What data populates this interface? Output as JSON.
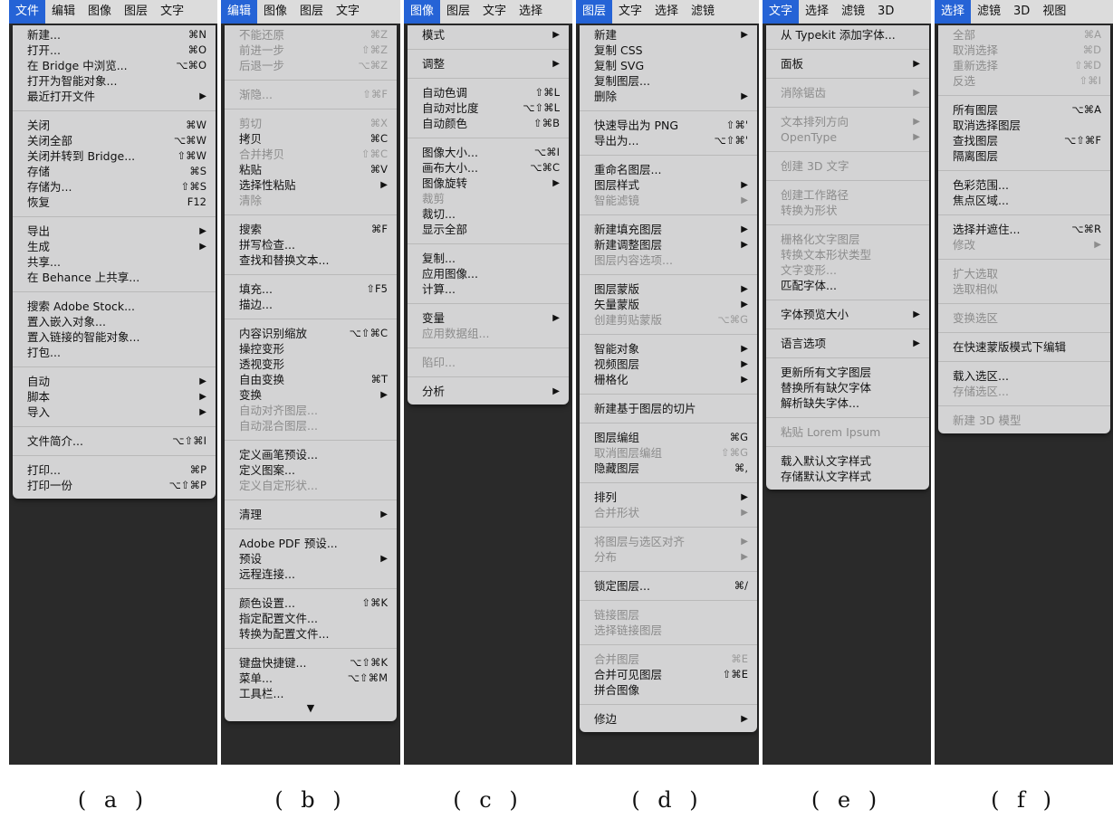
{
  "panels": [
    {
      "id": "a",
      "menubar": [
        "文件",
        "编辑",
        "图像",
        "图层",
        "文字"
      ],
      "active": 0,
      "items": [
        {
          "label": "新建...",
          "sc": "⌘N"
        },
        {
          "label": "打开...",
          "sc": "⌘O"
        },
        {
          "label": "在 Bridge 中浏览...",
          "sc": "⌥⌘O"
        },
        {
          "label": "打开为智能对象..."
        },
        {
          "label": "最近打开文件",
          "sub": true
        },
        {
          "sep": true
        },
        {
          "label": "关闭",
          "sc": "⌘W"
        },
        {
          "label": "关闭全部",
          "sc": "⌥⌘W"
        },
        {
          "label": "关闭并转到 Bridge...",
          "sc": "⇧⌘W"
        },
        {
          "label": "存储",
          "sc": "⌘S"
        },
        {
          "label": "存储为...",
          "sc": "⇧⌘S"
        },
        {
          "label": "恢复",
          "sc": "F12"
        },
        {
          "sep": true
        },
        {
          "label": "导出",
          "sub": true
        },
        {
          "label": "生成",
          "sub": true
        },
        {
          "label": "共享..."
        },
        {
          "label": "在 Behance 上共享..."
        },
        {
          "sep": true
        },
        {
          "label": "搜索 Adobe Stock..."
        },
        {
          "label": "置入嵌入对象..."
        },
        {
          "label": "置入链接的智能对象..."
        },
        {
          "label": "打包..."
        },
        {
          "sep": true
        },
        {
          "label": "自动",
          "sub": true
        },
        {
          "label": "脚本",
          "sub": true
        },
        {
          "label": "导入",
          "sub": true
        },
        {
          "sep": true
        },
        {
          "label": "文件简介...",
          "sc": "⌥⇧⌘I"
        },
        {
          "sep": true
        },
        {
          "label": "打印...",
          "sc": "⌘P"
        },
        {
          "label": "打印一份",
          "sc": "⌥⇧⌘P"
        }
      ]
    },
    {
      "id": "b",
      "menubar": [
        "编辑",
        "图像",
        "图层",
        "文字"
      ],
      "active": 0,
      "more": "▼",
      "items": [
        {
          "label": "不能还原",
          "sc": "⌘Z",
          "dis": true
        },
        {
          "label": "前进一步",
          "sc": "⇧⌘Z",
          "dis": true
        },
        {
          "label": "后退一步",
          "sc": "⌥⌘Z",
          "dis": true
        },
        {
          "sep": true
        },
        {
          "label": "渐隐...",
          "sc": "⇧⌘F",
          "dis": true
        },
        {
          "sep": true
        },
        {
          "label": "剪切",
          "sc": "⌘X",
          "dis": true
        },
        {
          "label": "拷贝",
          "sc": "⌘C"
        },
        {
          "label": "合并拷贝",
          "sc": "⇧⌘C",
          "dis": true
        },
        {
          "label": "粘贴",
          "sc": "⌘V"
        },
        {
          "label": "选择性粘贴",
          "sub": true
        },
        {
          "label": "清除",
          "dis": true
        },
        {
          "sep": true
        },
        {
          "label": "搜索",
          "sc": "⌘F"
        },
        {
          "label": "拼写检查..."
        },
        {
          "label": "查找和替换文本..."
        },
        {
          "sep": true
        },
        {
          "label": "填充...",
          "sc": "⇧F5"
        },
        {
          "label": "描边..."
        },
        {
          "sep": true
        },
        {
          "label": "内容识别缩放",
          "sc": "⌥⇧⌘C"
        },
        {
          "label": "操控变形"
        },
        {
          "label": "透视变形"
        },
        {
          "label": "自由变换",
          "sc": "⌘T"
        },
        {
          "label": "变换",
          "sub": true
        },
        {
          "label": "自动对齐图层...",
          "dis": true
        },
        {
          "label": "自动混合图层...",
          "dis": true
        },
        {
          "sep": true
        },
        {
          "label": "定义画笔预设..."
        },
        {
          "label": "定义图案..."
        },
        {
          "label": "定义自定形状...",
          "dis": true
        },
        {
          "sep": true
        },
        {
          "label": "清理",
          "sub": true
        },
        {
          "sep": true
        },
        {
          "label": "Adobe PDF 预设..."
        },
        {
          "label": "预设",
          "sub": true
        },
        {
          "label": "远程连接..."
        },
        {
          "sep": true
        },
        {
          "label": "颜色设置...",
          "sc": "⇧⌘K"
        },
        {
          "label": "指定配置文件..."
        },
        {
          "label": "转换为配置文件..."
        },
        {
          "sep": true
        },
        {
          "label": "键盘快捷键...",
          "sc": "⌥⇧⌘K"
        },
        {
          "label": "菜单...",
          "sc": "⌥⇧⌘M"
        },
        {
          "label": "工具栏..."
        }
      ]
    },
    {
      "id": "c",
      "menubar": [
        "图像",
        "图层",
        "文字",
        "选择"
      ],
      "active": 0,
      "items": [
        {
          "label": "模式",
          "sub": true
        },
        {
          "sep": true
        },
        {
          "label": "调整",
          "sub": true
        },
        {
          "sep": true
        },
        {
          "label": "自动色调",
          "sc": "⇧⌘L"
        },
        {
          "label": "自动对比度",
          "sc": "⌥⇧⌘L"
        },
        {
          "label": "自动颜色",
          "sc": "⇧⌘B"
        },
        {
          "sep": true
        },
        {
          "label": "图像大小...",
          "sc": "⌥⌘I"
        },
        {
          "label": "画布大小...",
          "sc": "⌥⌘C"
        },
        {
          "label": "图像旋转",
          "sub": true
        },
        {
          "label": "裁剪",
          "dis": true
        },
        {
          "label": "裁切..."
        },
        {
          "label": "显示全部"
        },
        {
          "sep": true
        },
        {
          "label": "复制..."
        },
        {
          "label": "应用图像..."
        },
        {
          "label": "计算..."
        },
        {
          "sep": true
        },
        {
          "label": "变量",
          "sub": true
        },
        {
          "label": "应用数据组...",
          "dis": true
        },
        {
          "sep": true
        },
        {
          "label": "陷印...",
          "dis": true
        },
        {
          "sep": true
        },
        {
          "label": "分析",
          "sub": true
        }
      ]
    },
    {
      "id": "d",
      "menubar": [
        "图层",
        "文字",
        "选择",
        "滤镜"
      ],
      "active": 0,
      "items": [
        {
          "label": "新建",
          "sub": true
        },
        {
          "label": "复制 CSS"
        },
        {
          "label": "复制 SVG"
        },
        {
          "label": "复制图层..."
        },
        {
          "label": "删除",
          "sub": true
        },
        {
          "sep": true
        },
        {
          "label": "快速导出为 PNG",
          "sc": "⇧⌘'"
        },
        {
          "label": "导出为...",
          "sc": "⌥⇧⌘'"
        },
        {
          "sep": true
        },
        {
          "label": "重命名图层..."
        },
        {
          "label": "图层样式",
          "sub": true
        },
        {
          "label": "智能滤镜",
          "sub": true,
          "dis": true
        },
        {
          "sep": true
        },
        {
          "label": "新建填充图层",
          "sub": true
        },
        {
          "label": "新建调整图层",
          "sub": true
        },
        {
          "label": "图层内容选项...",
          "dis": true
        },
        {
          "sep": true
        },
        {
          "label": "图层蒙版",
          "sub": true
        },
        {
          "label": "矢量蒙版",
          "sub": true
        },
        {
          "label": "创建剪贴蒙版",
          "sc": "⌥⌘G",
          "dis": true
        },
        {
          "sep": true
        },
        {
          "label": "智能对象",
          "sub": true
        },
        {
          "label": "视频图层",
          "sub": true
        },
        {
          "label": "栅格化",
          "sub": true
        },
        {
          "sep": true
        },
        {
          "label": "新建基于图层的切片"
        },
        {
          "sep": true
        },
        {
          "label": "图层编组",
          "sc": "⌘G"
        },
        {
          "label": "取消图层编组",
          "sc": "⇧⌘G",
          "dis": true
        },
        {
          "label": "隐藏图层",
          "sc": "⌘,"
        },
        {
          "sep": true
        },
        {
          "label": "排列",
          "sub": true
        },
        {
          "label": "合并形状",
          "sub": true,
          "dis": true
        },
        {
          "sep": true
        },
        {
          "label": "将图层与选区对齐",
          "sub": true,
          "dis": true
        },
        {
          "label": "分布",
          "sub": true,
          "dis": true
        },
        {
          "sep": true
        },
        {
          "label": "锁定图层...",
          "sc": "⌘/"
        },
        {
          "sep": true
        },
        {
          "label": "链接图层",
          "dis": true
        },
        {
          "label": "选择链接图层",
          "dis": true
        },
        {
          "sep": true
        },
        {
          "label": "合并图层",
          "sc": "⌘E",
          "dis": true
        },
        {
          "label": "合并可见图层",
          "sc": "⇧⌘E"
        },
        {
          "label": "拼合图像"
        },
        {
          "sep": true
        },
        {
          "label": "修边",
          "sub": true
        }
      ]
    },
    {
      "id": "e",
      "menubar": [
        "文字",
        "选择",
        "滤镜",
        "3D"
      ],
      "active": 0,
      "items": [
        {
          "label": "从 Typekit 添加字体..."
        },
        {
          "sep": true
        },
        {
          "label": "面板",
          "sub": true
        },
        {
          "sep": true
        },
        {
          "label": "消除锯齿",
          "sub": true,
          "dis": true
        },
        {
          "sep": true
        },
        {
          "label": "文本排列方向",
          "sub": true,
          "dis": true
        },
        {
          "label": "OpenType",
          "sub": true,
          "dis": true
        },
        {
          "sep": true
        },
        {
          "label": "创建 3D 文字",
          "dis": true
        },
        {
          "sep": true
        },
        {
          "label": "创建工作路径",
          "dis": true
        },
        {
          "label": "转换为形状",
          "dis": true
        },
        {
          "sep": true
        },
        {
          "label": "栅格化文字图层",
          "dis": true
        },
        {
          "label": "转换文本形状类型",
          "dis": true
        },
        {
          "label": "文字变形...",
          "dis": true
        },
        {
          "label": "匹配字体..."
        },
        {
          "sep": true
        },
        {
          "label": "字体预览大小",
          "sub": true
        },
        {
          "sep": true
        },
        {
          "label": "语言选项",
          "sub": true
        },
        {
          "sep": true
        },
        {
          "label": "更新所有文字图层"
        },
        {
          "label": "替换所有缺欠字体"
        },
        {
          "label": "解析缺失字体..."
        },
        {
          "sep": true
        },
        {
          "label": "粘贴 Lorem Ipsum",
          "dis": true
        },
        {
          "sep": true
        },
        {
          "label": "载入默认文字样式"
        },
        {
          "label": "存储默认文字样式"
        }
      ]
    },
    {
      "id": "f",
      "menubar": [
        "选择",
        "滤镜",
        "3D",
        "视图"
      ],
      "active": 0,
      "items": [
        {
          "label": "全部",
          "sc": "⌘A",
          "dis": true
        },
        {
          "label": "取消选择",
          "sc": "⌘D",
          "dis": true
        },
        {
          "label": "重新选择",
          "sc": "⇧⌘D",
          "dis": true
        },
        {
          "label": "反选",
          "sc": "⇧⌘I",
          "dis": true
        },
        {
          "sep": true
        },
        {
          "label": "所有图层",
          "sc": "⌥⌘A"
        },
        {
          "label": "取消选择图层"
        },
        {
          "label": "查找图层",
          "sc": "⌥⇧⌘F"
        },
        {
          "label": "隔离图层"
        },
        {
          "sep": true
        },
        {
          "label": "色彩范围..."
        },
        {
          "label": "焦点区域..."
        },
        {
          "sep": true
        },
        {
          "label": "选择并遮住...",
          "sc": "⌥⌘R"
        },
        {
          "label": "修改",
          "sub": true,
          "dis": true
        },
        {
          "sep": true
        },
        {
          "label": "扩大选取",
          "dis": true
        },
        {
          "label": "选取相似",
          "dis": true
        },
        {
          "sep": true
        },
        {
          "label": "变换选区",
          "dis": true
        },
        {
          "sep": true
        },
        {
          "label": "在快速蒙版模式下编辑"
        },
        {
          "sep": true
        },
        {
          "label": "载入选区..."
        },
        {
          "label": "存储选区...",
          "dis": true
        },
        {
          "sep": true
        },
        {
          "label": "新建 3D 模型",
          "dis": true
        }
      ]
    }
  ],
  "captions": [
    "( a )",
    "( b )",
    "( c )",
    "( d )",
    "( e )",
    "( f )"
  ]
}
